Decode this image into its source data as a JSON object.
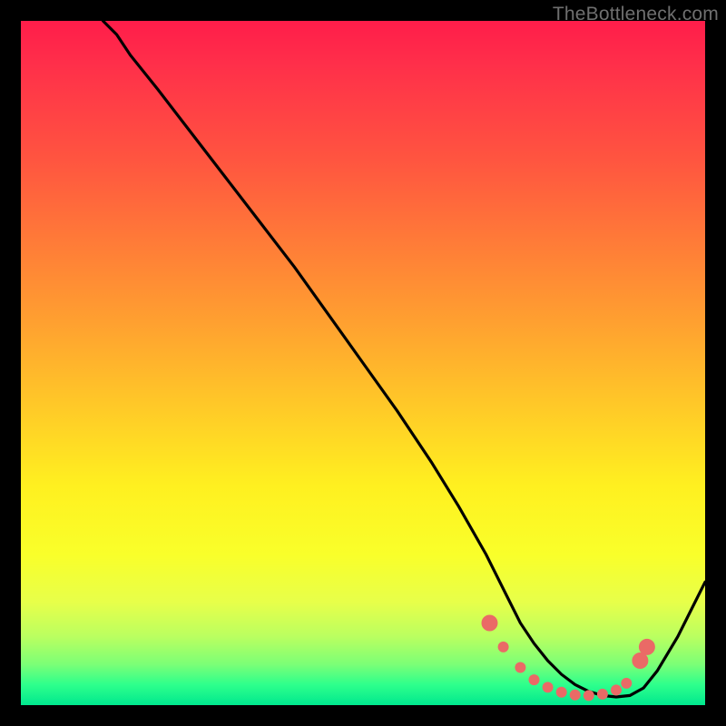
{
  "watermark": "TheBottleneck.com",
  "chart_data": {
    "type": "line",
    "title": "",
    "xlabel": "",
    "ylabel": "",
    "xlim": [
      0,
      100
    ],
    "ylim": [
      0,
      100
    ],
    "grid": false,
    "legend": false,
    "series": [
      {
        "name": "curve",
        "x": [
          12,
          14,
          16,
          20,
          25,
          30,
          35,
          40,
          45,
          50,
          55,
          60,
          64,
          68,
          71,
          73,
          75,
          77,
          79,
          81,
          83,
          85,
          87,
          89,
          91,
          93,
          96,
          100
        ],
        "y": [
          100,
          98,
          95,
          90,
          83.5,
          77,
          70.5,
          64,
          57,
          50,
          43,
          35.5,
          29,
          22,
          16,
          12,
          9,
          6.5,
          4.5,
          3,
          2,
          1.4,
          1.2,
          1.4,
          2.5,
          5,
          10,
          18
        ]
      }
    ],
    "markers": [
      {
        "x": 68.5,
        "y": 12.0,
        "size": "large"
      },
      {
        "x": 70.5,
        "y": 8.5,
        "size": "small"
      },
      {
        "x": 73.0,
        "y": 5.5,
        "size": "small"
      },
      {
        "x": 75.0,
        "y": 3.7,
        "size": "small"
      },
      {
        "x": 77.0,
        "y": 2.6,
        "size": "small"
      },
      {
        "x": 79.0,
        "y": 1.9,
        "size": "small"
      },
      {
        "x": 81.0,
        "y": 1.5,
        "size": "small"
      },
      {
        "x": 83.0,
        "y": 1.4,
        "size": "small"
      },
      {
        "x": 85.0,
        "y": 1.6,
        "size": "small"
      },
      {
        "x": 87.0,
        "y": 2.2,
        "size": "small"
      },
      {
        "x": 88.5,
        "y": 3.2,
        "size": "small"
      },
      {
        "x": 90.5,
        "y": 6.5,
        "size": "large"
      },
      {
        "x": 91.5,
        "y": 8.5,
        "size": "large"
      }
    ]
  }
}
